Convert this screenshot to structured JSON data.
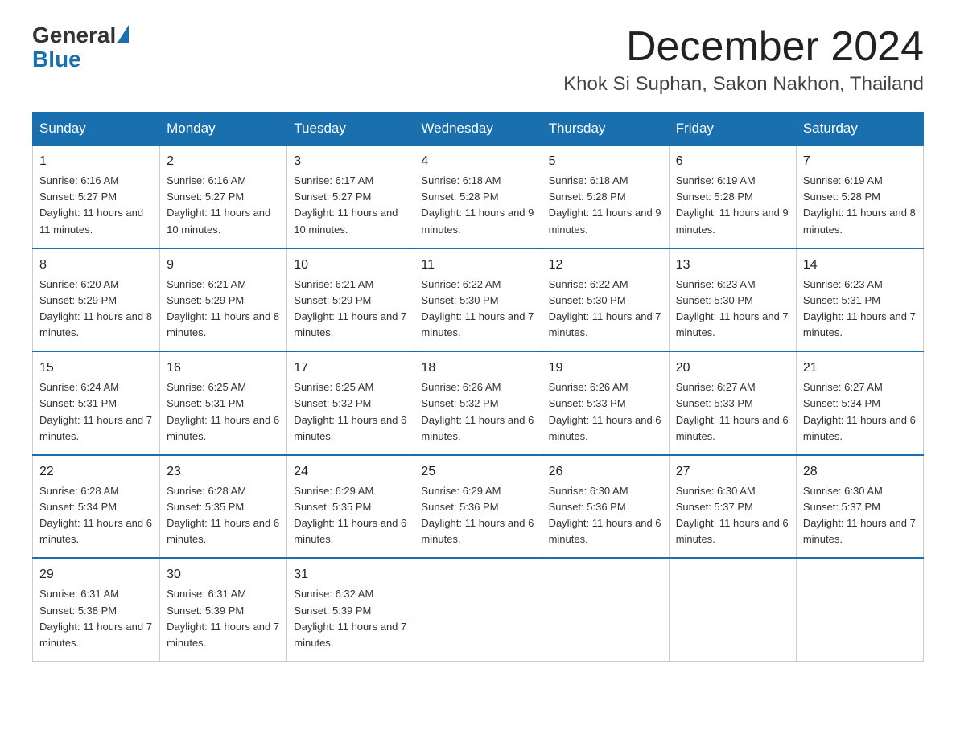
{
  "header": {
    "logo_general": "General",
    "logo_blue": "Blue",
    "month_title": "December 2024",
    "location": "Khok Si Suphan, Sakon Nakhon, Thailand"
  },
  "weekdays": [
    "Sunday",
    "Monday",
    "Tuesday",
    "Wednesday",
    "Thursday",
    "Friday",
    "Saturday"
  ],
  "weeks": [
    [
      {
        "day": "1",
        "sunrise": "6:16 AM",
        "sunset": "5:27 PM",
        "daylight": "11 hours and 11 minutes."
      },
      {
        "day": "2",
        "sunrise": "6:16 AM",
        "sunset": "5:27 PM",
        "daylight": "11 hours and 10 minutes."
      },
      {
        "day": "3",
        "sunrise": "6:17 AM",
        "sunset": "5:27 PM",
        "daylight": "11 hours and 10 minutes."
      },
      {
        "day": "4",
        "sunrise": "6:18 AM",
        "sunset": "5:28 PM",
        "daylight": "11 hours and 9 minutes."
      },
      {
        "day": "5",
        "sunrise": "6:18 AM",
        "sunset": "5:28 PM",
        "daylight": "11 hours and 9 minutes."
      },
      {
        "day": "6",
        "sunrise": "6:19 AM",
        "sunset": "5:28 PM",
        "daylight": "11 hours and 9 minutes."
      },
      {
        "day": "7",
        "sunrise": "6:19 AM",
        "sunset": "5:28 PM",
        "daylight": "11 hours and 8 minutes."
      }
    ],
    [
      {
        "day": "8",
        "sunrise": "6:20 AM",
        "sunset": "5:29 PM",
        "daylight": "11 hours and 8 minutes."
      },
      {
        "day": "9",
        "sunrise": "6:21 AM",
        "sunset": "5:29 PM",
        "daylight": "11 hours and 8 minutes."
      },
      {
        "day": "10",
        "sunrise": "6:21 AM",
        "sunset": "5:29 PM",
        "daylight": "11 hours and 7 minutes."
      },
      {
        "day": "11",
        "sunrise": "6:22 AM",
        "sunset": "5:30 PM",
        "daylight": "11 hours and 7 minutes."
      },
      {
        "day": "12",
        "sunrise": "6:22 AM",
        "sunset": "5:30 PM",
        "daylight": "11 hours and 7 minutes."
      },
      {
        "day": "13",
        "sunrise": "6:23 AM",
        "sunset": "5:30 PM",
        "daylight": "11 hours and 7 minutes."
      },
      {
        "day": "14",
        "sunrise": "6:23 AM",
        "sunset": "5:31 PM",
        "daylight": "11 hours and 7 minutes."
      }
    ],
    [
      {
        "day": "15",
        "sunrise": "6:24 AM",
        "sunset": "5:31 PM",
        "daylight": "11 hours and 7 minutes."
      },
      {
        "day": "16",
        "sunrise": "6:25 AM",
        "sunset": "5:31 PM",
        "daylight": "11 hours and 6 minutes."
      },
      {
        "day": "17",
        "sunrise": "6:25 AM",
        "sunset": "5:32 PM",
        "daylight": "11 hours and 6 minutes."
      },
      {
        "day": "18",
        "sunrise": "6:26 AM",
        "sunset": "5:32 PM",
        "daylight": "11 hours and 6 minutes."
      },
      {
        "day": "19",
        "sunrise": "6:26 AM",
        "sunset": "5:33 PM",
        "daylight": "11 hours and 6 minutes."
      },
      {
        "day": "20",
        "sunrise": "6:27 AM",
        "sunset": "5:33 PM",
        "daylight": "11 hours and 6 minutes."
      },
      {
        "day": "21",
        "sunrise": "6:27 AM",
        "sunset": "5:34 PM",
        "daylight": "11 hours and 6 minutes."
      }
    ],
    [
      {
        "day": "22",
        "sunrise": "6:28 AM",
        "sunset": "5:34 PM",
        "daylight": "11 hours and 6 minutes."
      },
      {
        "day": "23",
        "sunrise": "6:28 AM",
        "sunset": "5:35 PM",
        "daylight": "11 hours and 6 minutes."
      },
      {
        "day": "24",
        "sunrise": "6:29 AM",
        "sunset": "5:35 PM",
        "daylight": "11 hours and 6 minutes."
      },
      {
        "day": "25",
        "sunrise": "6:29 AM",
        "sunset": "5:36 PM",
        "daylight": "11 hours and 6 minutes."
      },
      {
        "day": "26",
        "sunrise": "6:30 AM",
        "sunset": "5:36 PM",
        "daylight": "11 hours and 6 minutes."
      },
      {
        "day": "27",
        "sunrise": "6:30 AM",
        "sunset": "5:37 PM",
        "daylight": "11 hours and 6 minutes."
      },
      {
        "day": "28",
        "sunrise": "6:30 AM",
        "sunset": "5:37 PM",
        "daylight": "11 hours and 7 minutes."
      }
    ],
    [
      {
        "day": "29",
        "sunrise": "6:31 AM",
        "sunset": "5:38 PM",
        "daylight": "11 hours and 7 minutes."
      },
      {
        "day": "30",
        "sunrise": "6:31 AM",
        "sunset": "5:39 PM",
        "daylight": "11 hours and 7 minutes."
      },
      {
        "day": "31",
        "sunrise": "6:32 AM",
        "sunset": "5:39 PM",
        "daylight": "11 hours and 7 minutes."
      },
      null,
      null,
      null,
      null
    ]
  ],
  "labels": {
    "sunrise_prefix": "Sunrise: ",
    "sunset_prefix": "Sunset: ",
    "daylight_prefix": "Daylight: "
  }
}
